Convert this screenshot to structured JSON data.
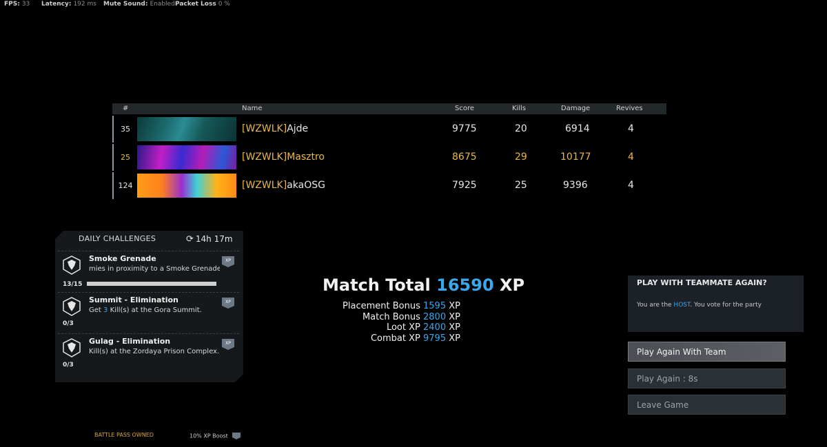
{
  "stats": {
    "fps_label": "FPS:",
    "fps_value": "33",
    "latency_label": "Latency:",
    "latency_value": "192 ms",
    "mute_label": "Mute Sound:",
    "mute_value": "Enabled",
    "loss_label": "Packet Loss",
    "loss_value": "0 %"
  },
  "scoreboard": {
    "headers": {
      "rank": "#",
      "name": "Name",
      "score": "Score",
      "kills": "Kills",
      "damage": "Damage",
      "revives": "Revives"
    },
    "rows": [
      {
        "rank": "35",
        "tag": "[WZWLK]",
        "name": "Ajde",
        "score": "9775",
        "kills": "20",
        "damage": "6914",
        "revives": "4"
      },
      {
        "rank": "25",
        "tag": "[WZWLK]",
        "name": "Masztro",
        "score": "8675",
        "kills": "29",
        "damage": "10177",
        "revives": "4"
      },
      {
        "rank": "124",
        "tag": "[WZWLK]",
        "name": "akaOSG",
        "score": "7925",
        "kills": "25",
        "damage": "9396",
        "revives": "4"
      }
    ]
  },
  "daily": {
    "title": "DAILY CHALLENGES",
    "timer": "14h 17m",
    "challenges": [
      {
        "title": "Smoke Grenade",
        "desc": "mies in proximity to a Smoke Grenade",
        "progress": "13/15",
        "fraction": 0.87
      },
      {
        "title": "Summit - Elimination",
        "desc_pre": "Get ",
        "desc_hl": "3",
        "desc_post": " Kill(s) at the Gora Summit.",
        "progress": "0/3"
      },
      {
        "title": "Gulag - Elimination",
        "desc": "Kill(s) at the Zordaya Prison Complex.",
        "progress": "0/3"
      }
    ]
  },
  "match": {
    "label": "Match Total",
    "total": "16590",
    "unit": "XP",
    "lines": [
      {
        "label": "Placement Bonus",
        "value": "1595",
        "unit": "XP"
      },
      {
        "label": "Match Bonus",
        "value": "2800",
        "unit": "XP"
      },
      {
        "label": "Loot XP",
        "value": "2400",
        "unit": "XP"
      },
      {
        "label": "Combat XP",
        "value": "9795",
        "unit": "XP"
      }
    ]
  },
  "party": {
    "title": "PLAY WITH TEAMMATE AGAIN?",
    "desc_pre": "You are the ",
    "desc_hl": "HOST",
    "desc_post": ". You vote for the party",
    "buttons": {
      "again_team": "Play Again With Team",
      "again": "Play Again : 8s",
      "leave": "Leave Game"
    }
  },
  "footer": {
    "battle_pass": "BATTLE PASS OWNED",
    "boost": "10% XP Boost"
  },
  "colors": {
    "accent_blue": "#3aa8ea",
    "clan_gold": "#e9b84a",
    "background": "#000000"
  }
}
